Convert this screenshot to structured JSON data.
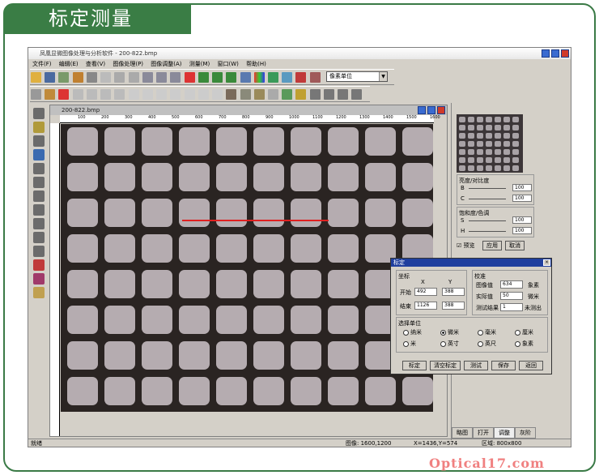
{
  "slide_title": "标定测量",
  "app": {
    "title": "凤凰显微图像处理与分析软件  -  200-822.bmp",
    "menu": [
      "文件(F)",
      "编辑(E)",
      "查看(V)",
      "图像处理(P)",
      "图像调整(A)",
      "测量(M)",
      "窗口(W)",
      "帮助(H)"
    ],
    "unit_select": "像素单位"
  },
  "image_window": {
    "title": "200-822.bmp",
    "ruler_ticks": [
      "100",
      "200",
      "300",
      "400",
      "500",
      "600",
      "700",
      "800",
      "900",
      "1000",
      "1100",
      "1200",
      "1300",
      "1400",
      "1500",
      "1600"
    ]
  },
  "right_panel": {
    "brightness_group": "亮度/对比度",
    "b_label": "B",
    "c_label": "C",
    "b_value": "100",
    "c_value": "100",
    "saturation_group": "饱和度/色调",
    "s_label": "S",
    "h_label": "H",
    "s_value": "100",
    "h_value": "100",
    "preview_label": "预览",
    "apply_label": "应用",
    "cancel_label": "取消",
    "tabs": [
      "略图",
      "打开",
      "调整",
      "灰阶"
    ]
  },
  "dialog": {
    "title": "标定",
    "coords_group": "坐标",
    "x_header": "X",
    "y_header": "Y",
    "start_label": "开始",
    "end_label": "结束",
    "start_x": "492",
    "start_y": "388",
    "end_x": "1126",
    "end_y": "388",
    "calib_group": "校准",
    "image_value_label": "图像值",
    "image_value": "634",
    "image_unit": "象素",
    "actual_label": "实际值",
    "actual_value": "50",
    "actual_unit": "微米",
    "test_label": "测试结果",
    "test_value": "1",
    "test_unit": "未测出",
    "unit_group": "选择单位",
    "units": [
      "纳米",
      "微米",
      "毫米",
      "厘米",
      "米",
      "英寸",
      "英尺",
      "象素"
    ],
    "buttons": [
      "标定",
      "清空标定",
      "测试",
      "保存",
      "返回"
    ]
  },
  "status": {
    "left": "就绪",
    "image_size": "图像: 1600,1200",
    "cursor": "X=1436,Y=574",
    "area": "区域: 800x800"
  },
  "watermark": "Optical17.com",
  "colors": {
    "slide_green": "#3a7d45",
    "dialog_title": "#1f3f9e",
    "measure_line": "#e02020"
  }
}
